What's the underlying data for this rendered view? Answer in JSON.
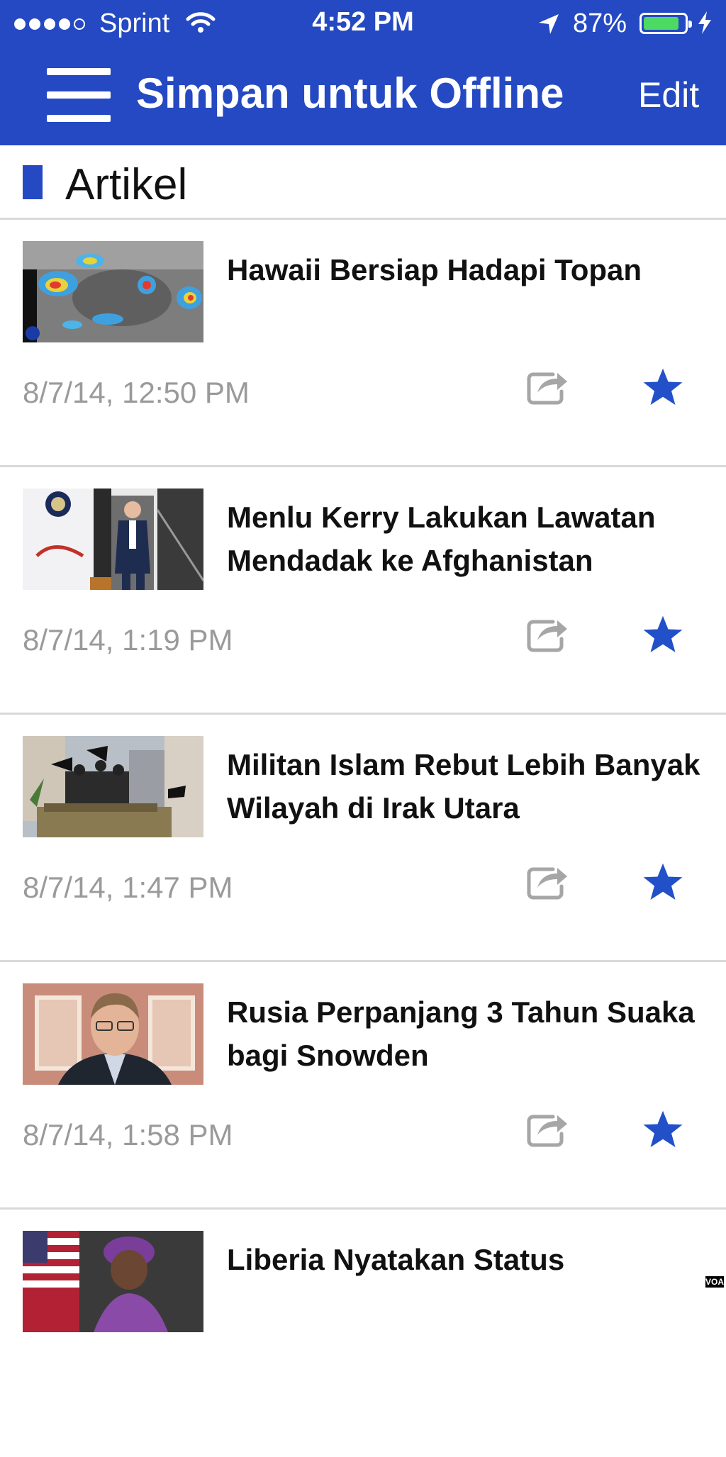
{
  "status_bar": {
    "carrier": "Sprint",
    "time": "4:52 PM",
    "battery_pct": "87%",
    "battery_level": 0.87,
    "signal_bars_filled": 4,
    "signal_bars_total": 5
  },
  "nav": {
    "menu_icon": "hamburger-menu-icon",
    "title": "Simpan untuk Offline",
    "edit_label": "Edit"
  },
  "section": {
    "title": "Artikel"
  },
  "colors": {
    "brand_blue": "#2449c2",
    "star_blue": "#2250c8",
    "date_gray": "#9a9a9a",
    "share_gray": "#a6a6a6",
    "divider": "#d9d9d9"
  },
  "articles": [
    {
      "title": "Hawaii Bersiap Hadapi Topan",
      "date": "8/7/14, 12:50 PM",
      "thumb": "satellite-weather-map",
      "favorited": true
    },
    {
      "title": "Menlu Kerry Lakukan Lawatan Mendadak ke Afghanistan",
      "date": "8/7/14, 1:19 PM",
      "thumb": "man-exiting-plane",
      "favorited": true
    },
    {
      "title": "Militan Islam Rebut Lebih Banyak Wilayah di Irak Utara",
      "date": "8/7/14, 1:47 PM",
      "thumb": "militants-on-tank",
      "favorited": true
    },
    {
      "title": "Rusia Perpanjang 3 Tahun Suaka bagi Snowden",
      "date": "8/7/14, 1:58 PM",
      "thumb": "man-portrait",
      "favorited": true
    },
    {
      "title": "Liberia Nyatakan Status",
      "date": "",
      "thumb": "woman-with-flag",
      "favorited": true
    }
  ],
  "watermark": "VOA"
}
